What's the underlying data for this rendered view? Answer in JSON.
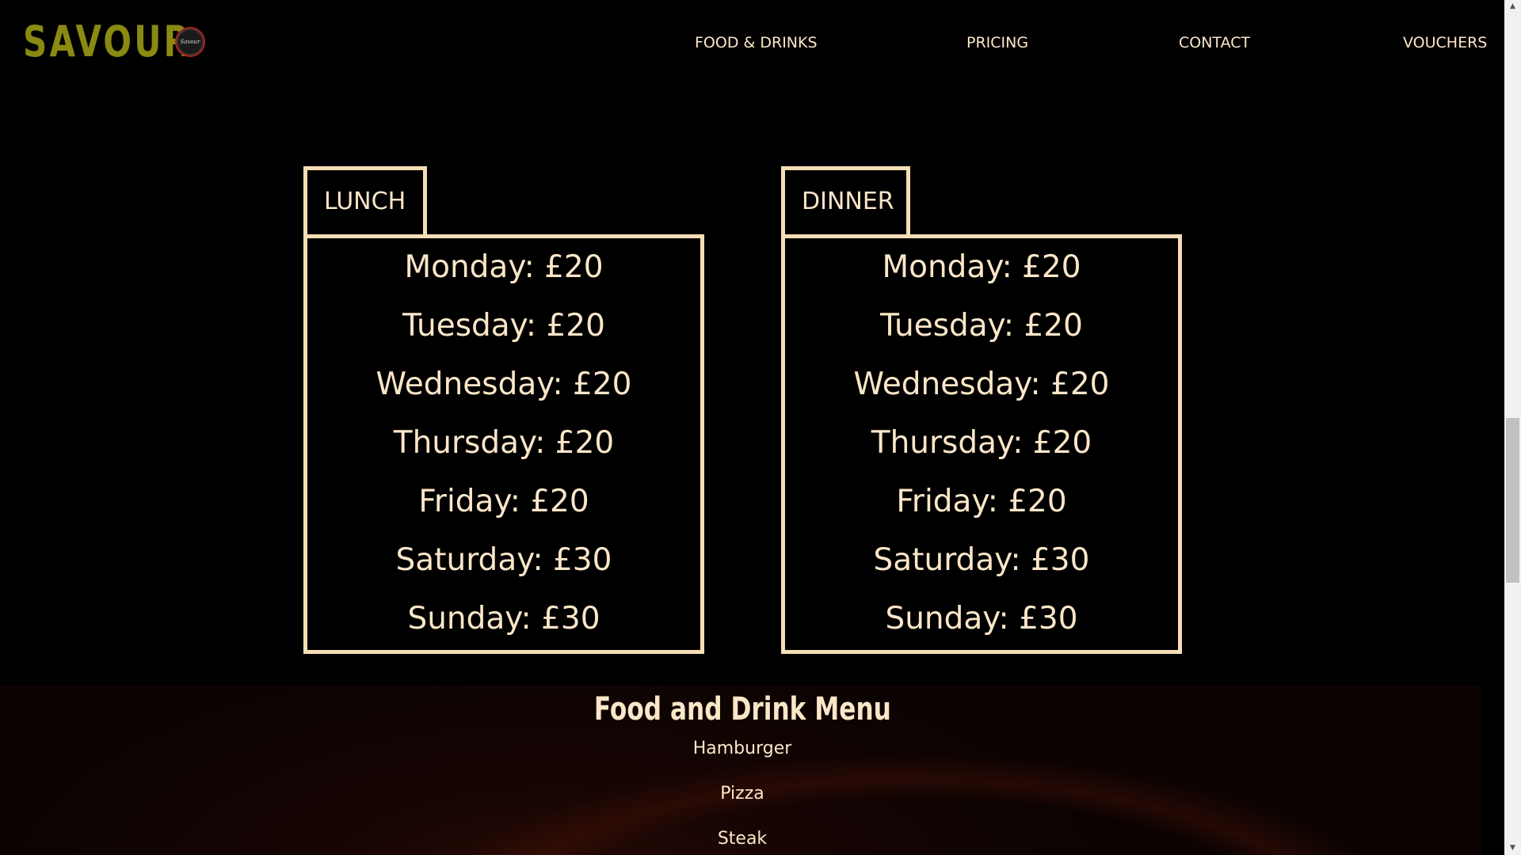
{
  "brand": {
    "name": "SAVOUR",
    "badge_text": "Savour",
    "name_color": "#8a8a12"
  },
  "nav": {
    "items": [
      "FOOD & DRINKS",
      "PRICING",
      "CONTACT",
      "VOUCHERS"
    ]
  },
  "pricing": {
    "lunch": {
      "label": "LUNCH",
      "rows": [
        "Monday: £20",
        "Tuesday: £20",
        "Wednesday: £20",
        "Thursday: £20",
        "Friday: £20",
        "Saturday: £30",
        "Sunday: £30"
      ]
    },
    "dinner": {
      "label": "DINNER",
      "rows": [
        "Monday: £20",
        "Tuesday: £20",
        "Wednesday: £20",
        "Thursday: £20",
        "Friday: £20",
        "Saturday: £30",
        "Sunday: £30"
      ]
    }
  },
  "menu": {
    "title": "Food and Drink Menu",
    "items": [
      "Hamburger",
      "Pizza",
      "Steak"
    ]
  },
  "colors": {
    "accent": "#f6deb6",
    "text": "#fbe6c8",
    "background": "#000000"
  },
  "icons": {
    "scroll_up": "triangle-up",
    "scroll_down": "triangle-down"
  }
}
